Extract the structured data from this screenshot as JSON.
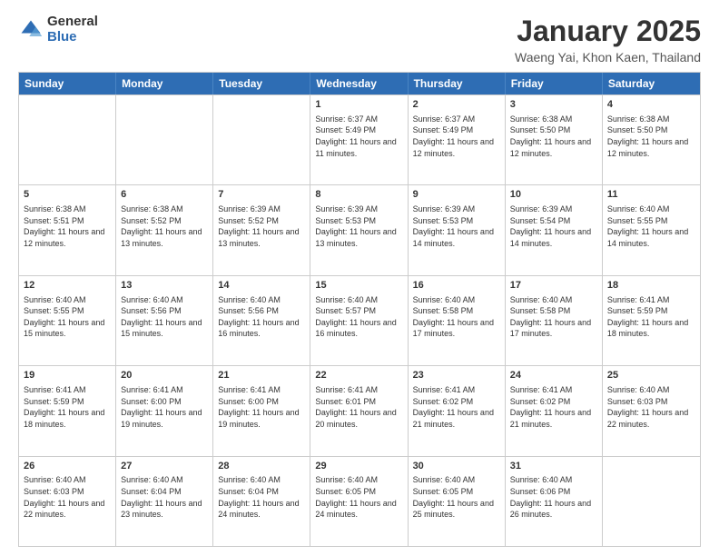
{
  "header": {
    "logo_general": "General",
    "logo_blue": "Blue",
    "title": "January 2025",
    "subtitle": "Waeng Yai, Khon Kaen, Thailand"
  },
  "weekdays": [
    "Sunday",
    "Monday",
    "Tuesday",
    "Wednesday",
    "Thursday",
    "Friday",
    "Saturday"
  ],
  "weeks": [
    [
      {
        "day": "",
        "info": ""
      },
      {
        "day": "",
        "info": ""
      },
      {
        "day": "",
        "info": ""
      },
      {
        "day": "1",
        "info": "Sunrise: 6:37 AM\nSunset: 5:49 PM\nDaylight: 11 hours and 11 minutes."
      },
      {
        "day": "2",
        "info": "Sunrise: 6:37 AM\nSunset: 5:49 PM\nDaylight: 11 hours and 12 minutes."
      },
      {
        "day": "3",
        "info": "Sunrise: 6:38 AM\nSunset: 5:50 PM\nDaylight: 11 hours and 12 minutes."
      },
      {
        "day": "4",
        "info": "Sunrise: 6:38 AM\nSunset: 5:50 PM\nDaylight: 11 hours and 12 minutes."
      }
    ],
    [
      {
        "day": "5",
        "info": "Sunrise: 6:38 AM\nSunset: 5:51 PM\nDaylight: 11 hours and 12 minutes."
      },
      {
        "day": "6",
        "info": "Sunrise: 6:38 AM\nSunset: 5:52 PM\nDaylight: 11 hours and 13 minutes."
      },
      {
        "day": "7",
        "info": "Sunrise: 6:39 AM\nSunset: 5:52 PM\nDaylight: 11 hours and 13 minutes."
      },
      {
        "day": "8",
        "info": "Sunrise: 6:39 AM\nSunset: 5:53 PM\nDaylight: 11 hours and 13 minutes."
      },
      {
        "day": "9",
        "info": "Sunrise: 6:39 AM\nSunset: 5:53 PM\nDaylight: 11 hours and 14 minutes."
      },
      {
        "day": "10",
        "info": "Sunrise: 6:39 AM\nSunset: 5:54 PM\nDaylight: 11 hours and 14 minutes."
      },
      {
        "day": "11",
        "info": "Sunrise: 6:40 AM\nSunset: 5:55 PM\nDaylight: 11 hours and 14 minutes."
      }
    ],
    [
      {
        "day": "12",
        "info": "Sunrise: 6:40 AM\nSunset: 5:55 PM\nDaylight: 11 hours and 15 minutes."
      },
      {
        "day": "13",
        "info": "Sunrise: 6:40 AM\nSunset: 5:56 PM\nDaylight: 11 hours and 15 minutes."
      },
      {
        "day": "14",
        "info": "Sunrise: 6:40 AM\nSunset: 5:56 PM\nDaylight: 11 hours and 16 minutes."
      },
      {
        "day": "15",
        "info": "Sunrise: 6:40 AM\nSunset: 5:57 PM\nDaylight: 11 hours and 16 minutes."
      },
      {
        "day": "16",
        "info": "Sunrise: 6:40 AM\nSunset: 5:58 PM\nDaylight: 11 hours and 17 minutes."
      },
      {
        "day": "17",
        "info": "Sunrise: 6:40 AM\nSunset: 5:58 PM\nDaylight: 11 hours and 17 minutes."
      },
      {
        "day": "18",
        "info": "Sunrise: 6:41 AM\nSunset: 5:59 PM\nDaylight: 11 hours and 18 minutes."
      }
    ],
    [
      {
        "day": "19",
        "info": "Sunrise: 6:41 AM\nSunset: 5:59 PM\nDaylight: 11 hours and 18 minutes."
      },
      {
        "day": "20",
        "info": "Sunrise: 6:41 AM\nSunset: 6:00 PM\nDaylight: 11 hours and 19 minutes."
      },
      {
        "day": "21",
        "info": "Sunrise: 6:41 AM\nSunset: 6:00 PM\nDaylight: 11 hours and 19 minutes."
      },
      {
        "day": "22",
        "info": "Sunrise: 6:41 AM\nSunset: 6:01 PM\nDaylight: 11 hours and 20 minutes."
      },
      {
        "day": "23",
        "info": "Sunrise: 6:41 AM\nSunset: 6:02 PM\nDaylight: 11 hours and 21 minutes."
      },
      {
        "day": "24",
        "info": "Sunrise: 6:41 AM\nSunset: 6:02 PM\nDaylight: 11 hours and 21 minutes."
      },
      {
        "day": "25",
        "info": "Sunrise: 6:40 AM\nSunset: 6:03 PM\nDaylight: 11 hours and 22 minutes."
      }
    ],
    [
      {
        "day": "26",
        "info": "Sunrise: 6:40 AM\nSunset: 6:03 PM\nDaylight: 11 hours and 22 minutes."
      },
      {
        "day": "27",
        "info": "Sunrise: 6:40 AM\nSunset: 6:04 PM\nDaylight: 11 hours and 23 minutes."
      },
      {
        "day": "28",
        "info": "Sunrise: 6:40 AM\nSunset: 6:04 PM\nDaylight: 11 hours and 24 minutes."
      },
      {
        "day": "29",
        "info": "Sunrise: 6:40 AM\nSunset: 6:05 PM\nDaylight: 11 hours and 24 minutes."
      },
      {
        "day": "30",
        "info": "Sunrise: 6:40 AM\nSunset: 6:05 PM\nDaylight: 11 hours and 25 minutes."
      },
      {
        "day": "31",
        "info": "Sunrise: 6:40 AM\nSunset: 6:06 PM\nDaylight: 11 hours and 26 minutes."
      },
      {
        "day": "",
        "info": ""
      }
    ]
  ]
}
